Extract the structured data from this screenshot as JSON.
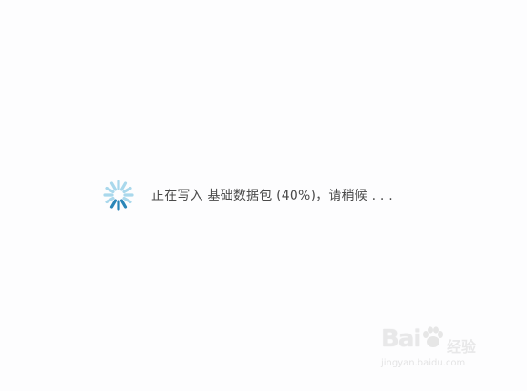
{
  "status": {
    "message": "正在写入 基础数据包 (40%)，请稍候 . . .",
    "progress_percent": 40
  },
  "spinner": {
    "icon": "loading-spinner-icon",
    "color_light": "#a9d8ec",
    "color_dark": "#2a86b8"
  },
  "watermark": {
    "logo_text_a": "Bai",
    "logo_text_b": "经验",
    "url": "jingyan.baidu.com"
  }
}
